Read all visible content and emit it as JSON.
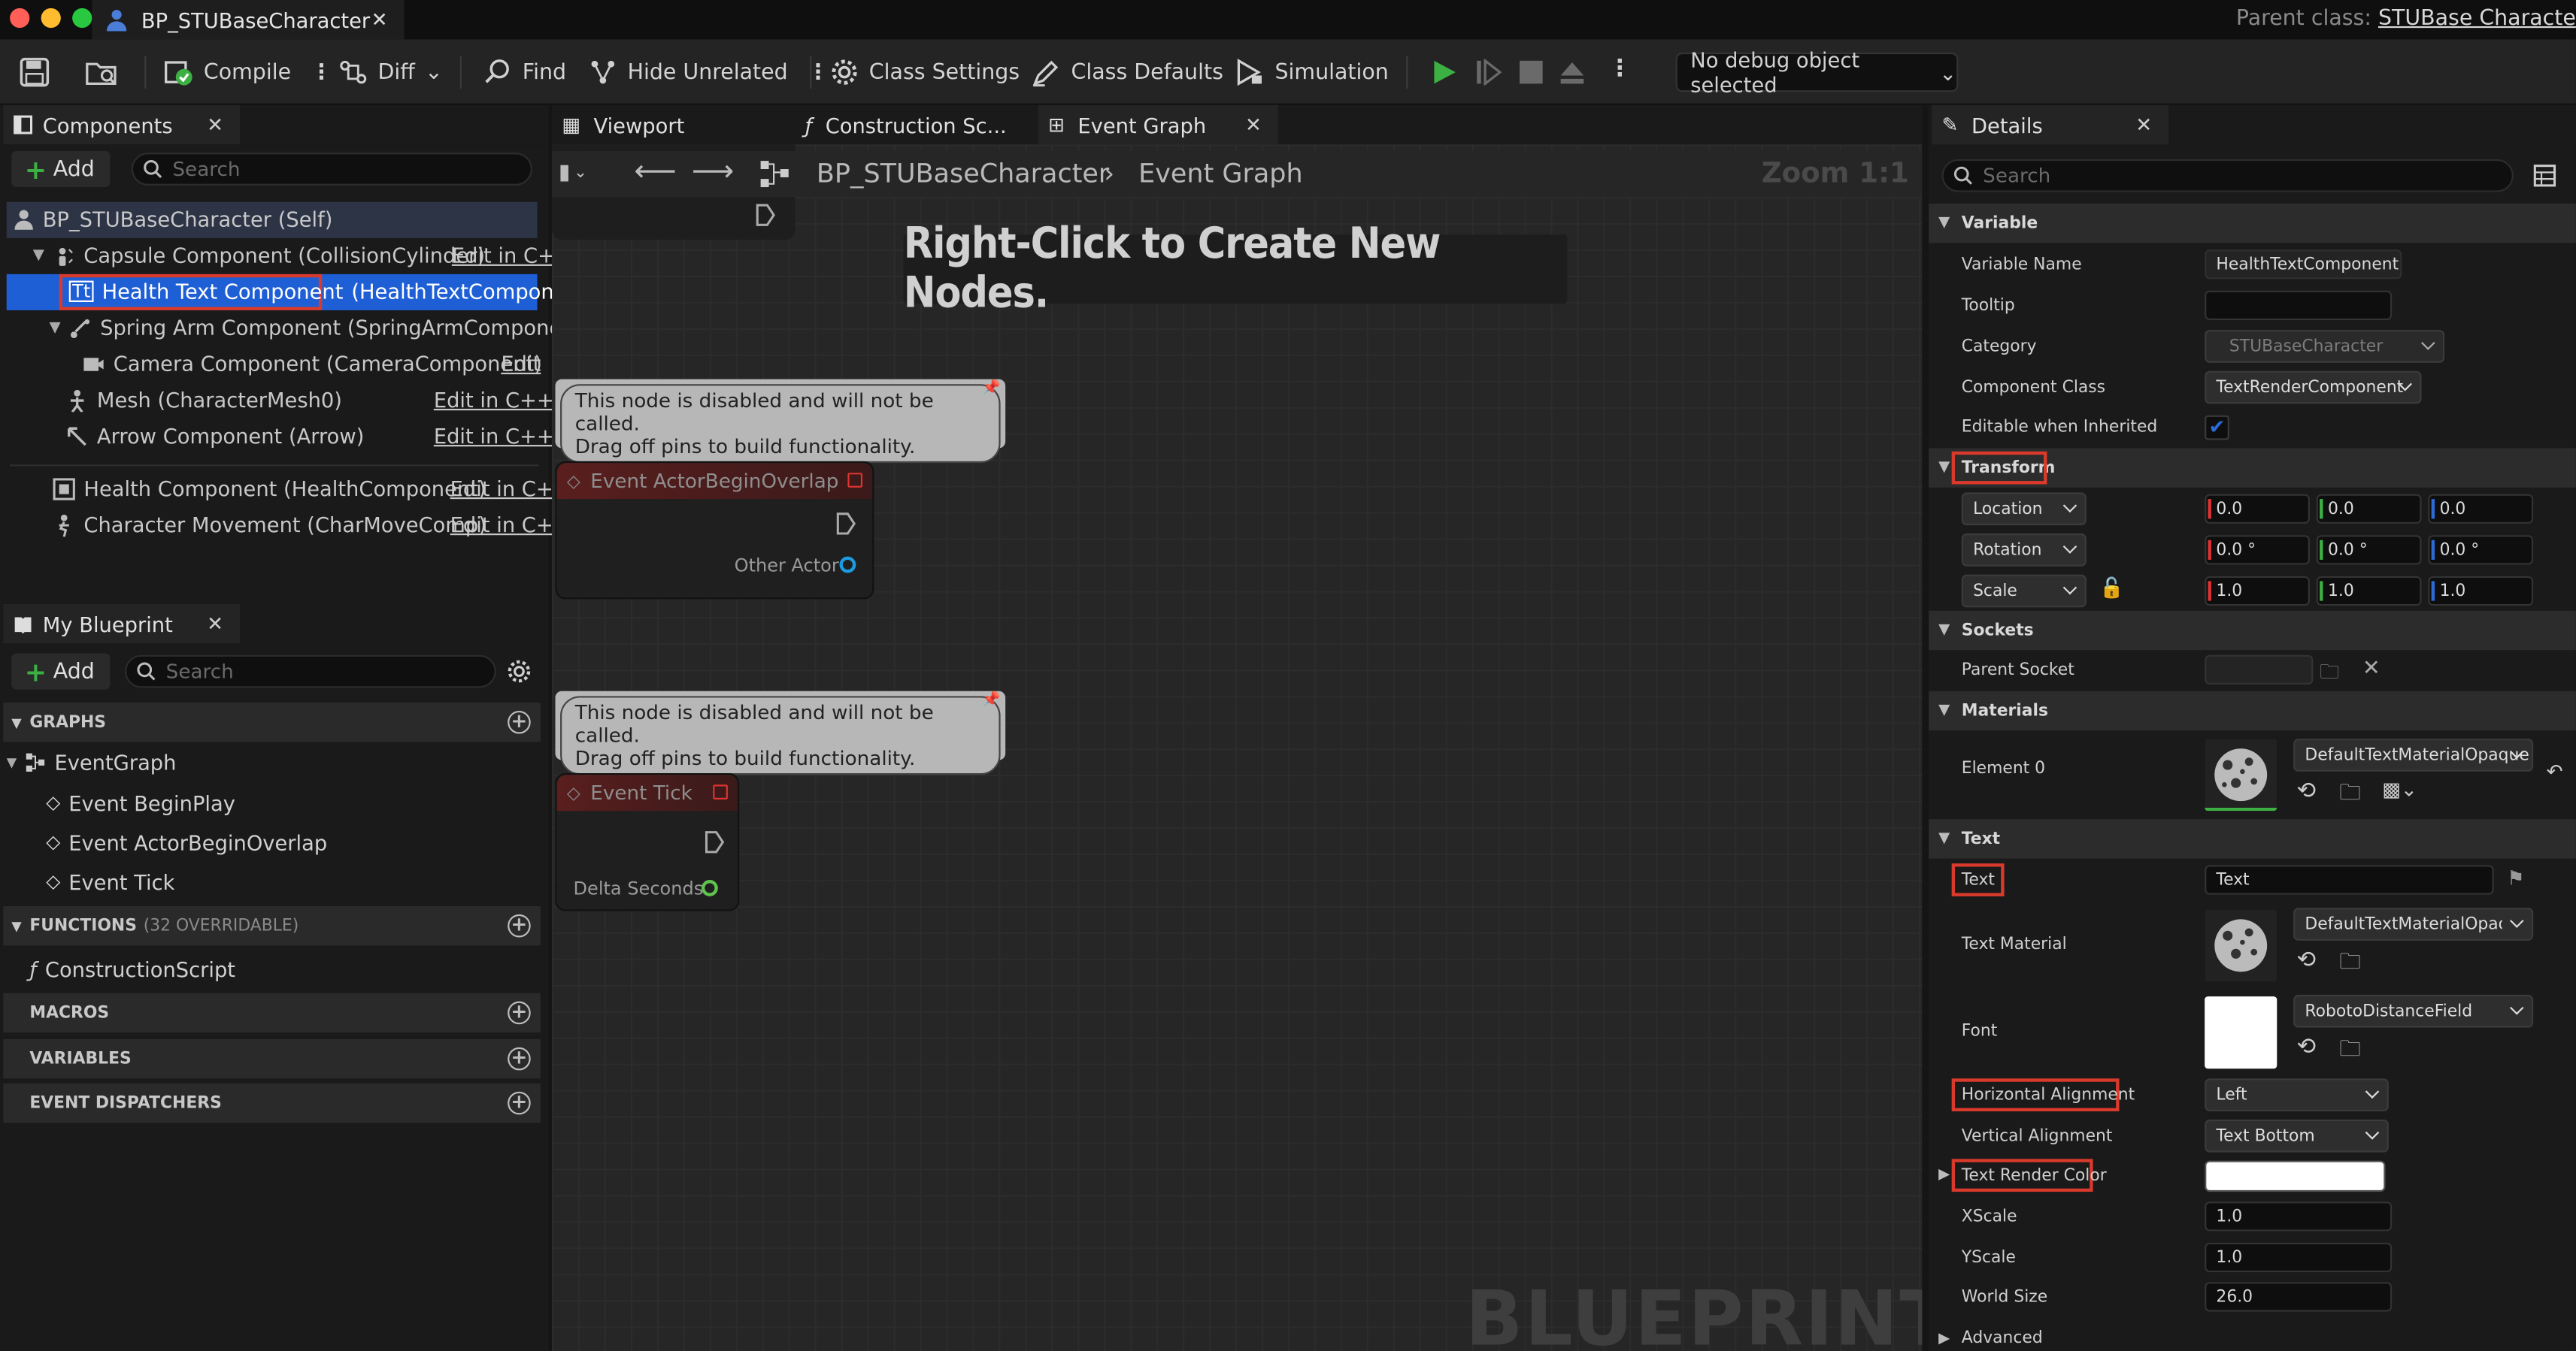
{
  "window": {
    "document_tab": "BP_STUBaseCharacter",
    "parent_class_label": "Parent class:",
    "parent_class_value": "STUBase Characte"
  },
  "toolbar": {
    "compile": "Compile",
    "diff": "Diff",
    "find": "Find",
    "hide_unrelated": "Hide Unrelated",
    "class_settings": "Class Settings",
    "class_defaults": "Class Defaults",
    "simulation": "Simulation",
    "debug_object": "No debug object selected"
  },
  "components_panel": {
    "title": "Components",
    "add": "Add",
    "search_placeholder": "Search",
    "items": [
      {
        "label": "BP_STUBaseCharacter (Self)"
      },
      {
        "label": "Capsule Component (CollisionCylinder)",
        "edit": "Edit in C+"
      },
      {
        "label": "Health Text Component",
        "suffix": "(HealthTextComponent)"
      },
      {
        "label": "Spring Arm Component (SpringArmComponent)"
      },
      {
        "label": "Camera Component (CameraComponent)",
        "edit": "Edit"
      },
      {
        "label": "Mesh (CharacterMesh0)",
        "edit": "Edit in C++"
      },
      {
        "label": "Arrow Component (Arrow)",
        "edit": "Edit in C++"
      },
      {
        "label": "Health Component (HealthComponent)",
        "edit": "Edit in C+"
      },
      {
        "label": "Character Movement (CharMoveComp)",
        "edit": "Edit in C+"
      }
    ]
  },
  "my_blueprint": {
    "title": "My Blueprint",
    "add": "Add",
    "search_placeholder": "Search",
    "graphs_header": "GRAPHS",
    "event_graph": "EventGraph",
    "events": [
      "Event BeginPlay",
      "Event ActorBeginOverlap",
      "Event Tick"
    ],
    "functions_header": "FUNCTIONS",
    "functions_count": "(32 OVERRIDABLE)",
    "construction_script": "ConstructionScript",
    "macros_header": "MACROS",
    "variables_header": "VARIABLES",
    "dispatchers_header": "EVENT DISPATCHERS"
  },
  "editor_tabs": {
    "viewport": "Viewport",
    "construction": "Construction Sc...",
    "event_graph": "Event Graph"
  },
  "graph": {
    "breadcrumb_root": "BP_STUBaseCharacter",
    "breadcrumb_leaf": "Event Graph",
    "zoom": "Zoom 1:1",
    "hint": "Right-Click to Create New Nodes.",
    "disabled_note_line1": "This node is disabled and will not be called.",
    "disabled_note_line2": "Drag off pins to build functionality.",
    "node_overlap_title": "Event ActorBeginOverlap",
    "node_overlap_pin": "Other Actor",
    "node_tick_title": "Event Tick",
    "node_tick_pin": "Delta Seconds",
    "watermark": "BLUEPRINT"
  },
  "details": {
    "title": "Details",
    "search_placeholder": "Search",
    "sec_variable": "Variable",
    "variable_name_label": "Variable Name",
    "variable_name": "HealthTextComponent",
    "tooltip_label": "Tooltip",
    "tooltip": "",
    "category_label": "Category",
    "category": "STUBaseCharacter",
    "component_class_label": "Component Class",
    "component_class": "TextRenderComponent",
    "editable_label": "Editable when Inherited",
    "editable_checked": true,
    "sec_transform": "Transform",
    "location": "Location",
    "rotation": "Rotation",
    "scale": "Scale",
    "loc": [
      "0.0",
      "0.0",
      "0.0"
    ],
    "rot": [
      "0.0 °",
      "0.0 °",
      "0.0 °"
    ],
    "scl": [
      "1.0",
      "1.0",
      "1.0"
    ],
    "sec_sockets": "Sockets",
    "parent_socket_label": "Parent Socket",
    "sec_materials": "Materials",
    "element0_label": "Element 0",
    "element0": "DefaultTextMaterialOpaque",
    "sec_text": "Text",
    "text_label": "Text",
    "text_value": "Text",
    "text_material_label": "Text Material",
    "text_material": "DefaultTextMaterialOpaque",
    "font_label": "Font",
    "font": "RobotoDistanceField",
    "halign_label": "Horizontal Alignment",
    "halign": "Left",
    "valign_label": "Vertical Alignment",
    "valign": "Text Bottom",
    "color_label": "Text Render Color",
    "color_value": "#ffffff",
    "xscale_label": "XScale",
    "xscale": "1.0",
    "yscale_label": "YScale",
    "yscale": "1.0",
    "worldsize_label": "World Size",
    "worldsize": "26.0",
    "sec_advanced": "Advanced"
  },
  "colors": {
    "accent_blue": "#1f5fd6",
    "highlight_red": "#d93a2b",
    "play_green": "#3cb043",
    "check_blue": "#2a6bd6"
  }
}
